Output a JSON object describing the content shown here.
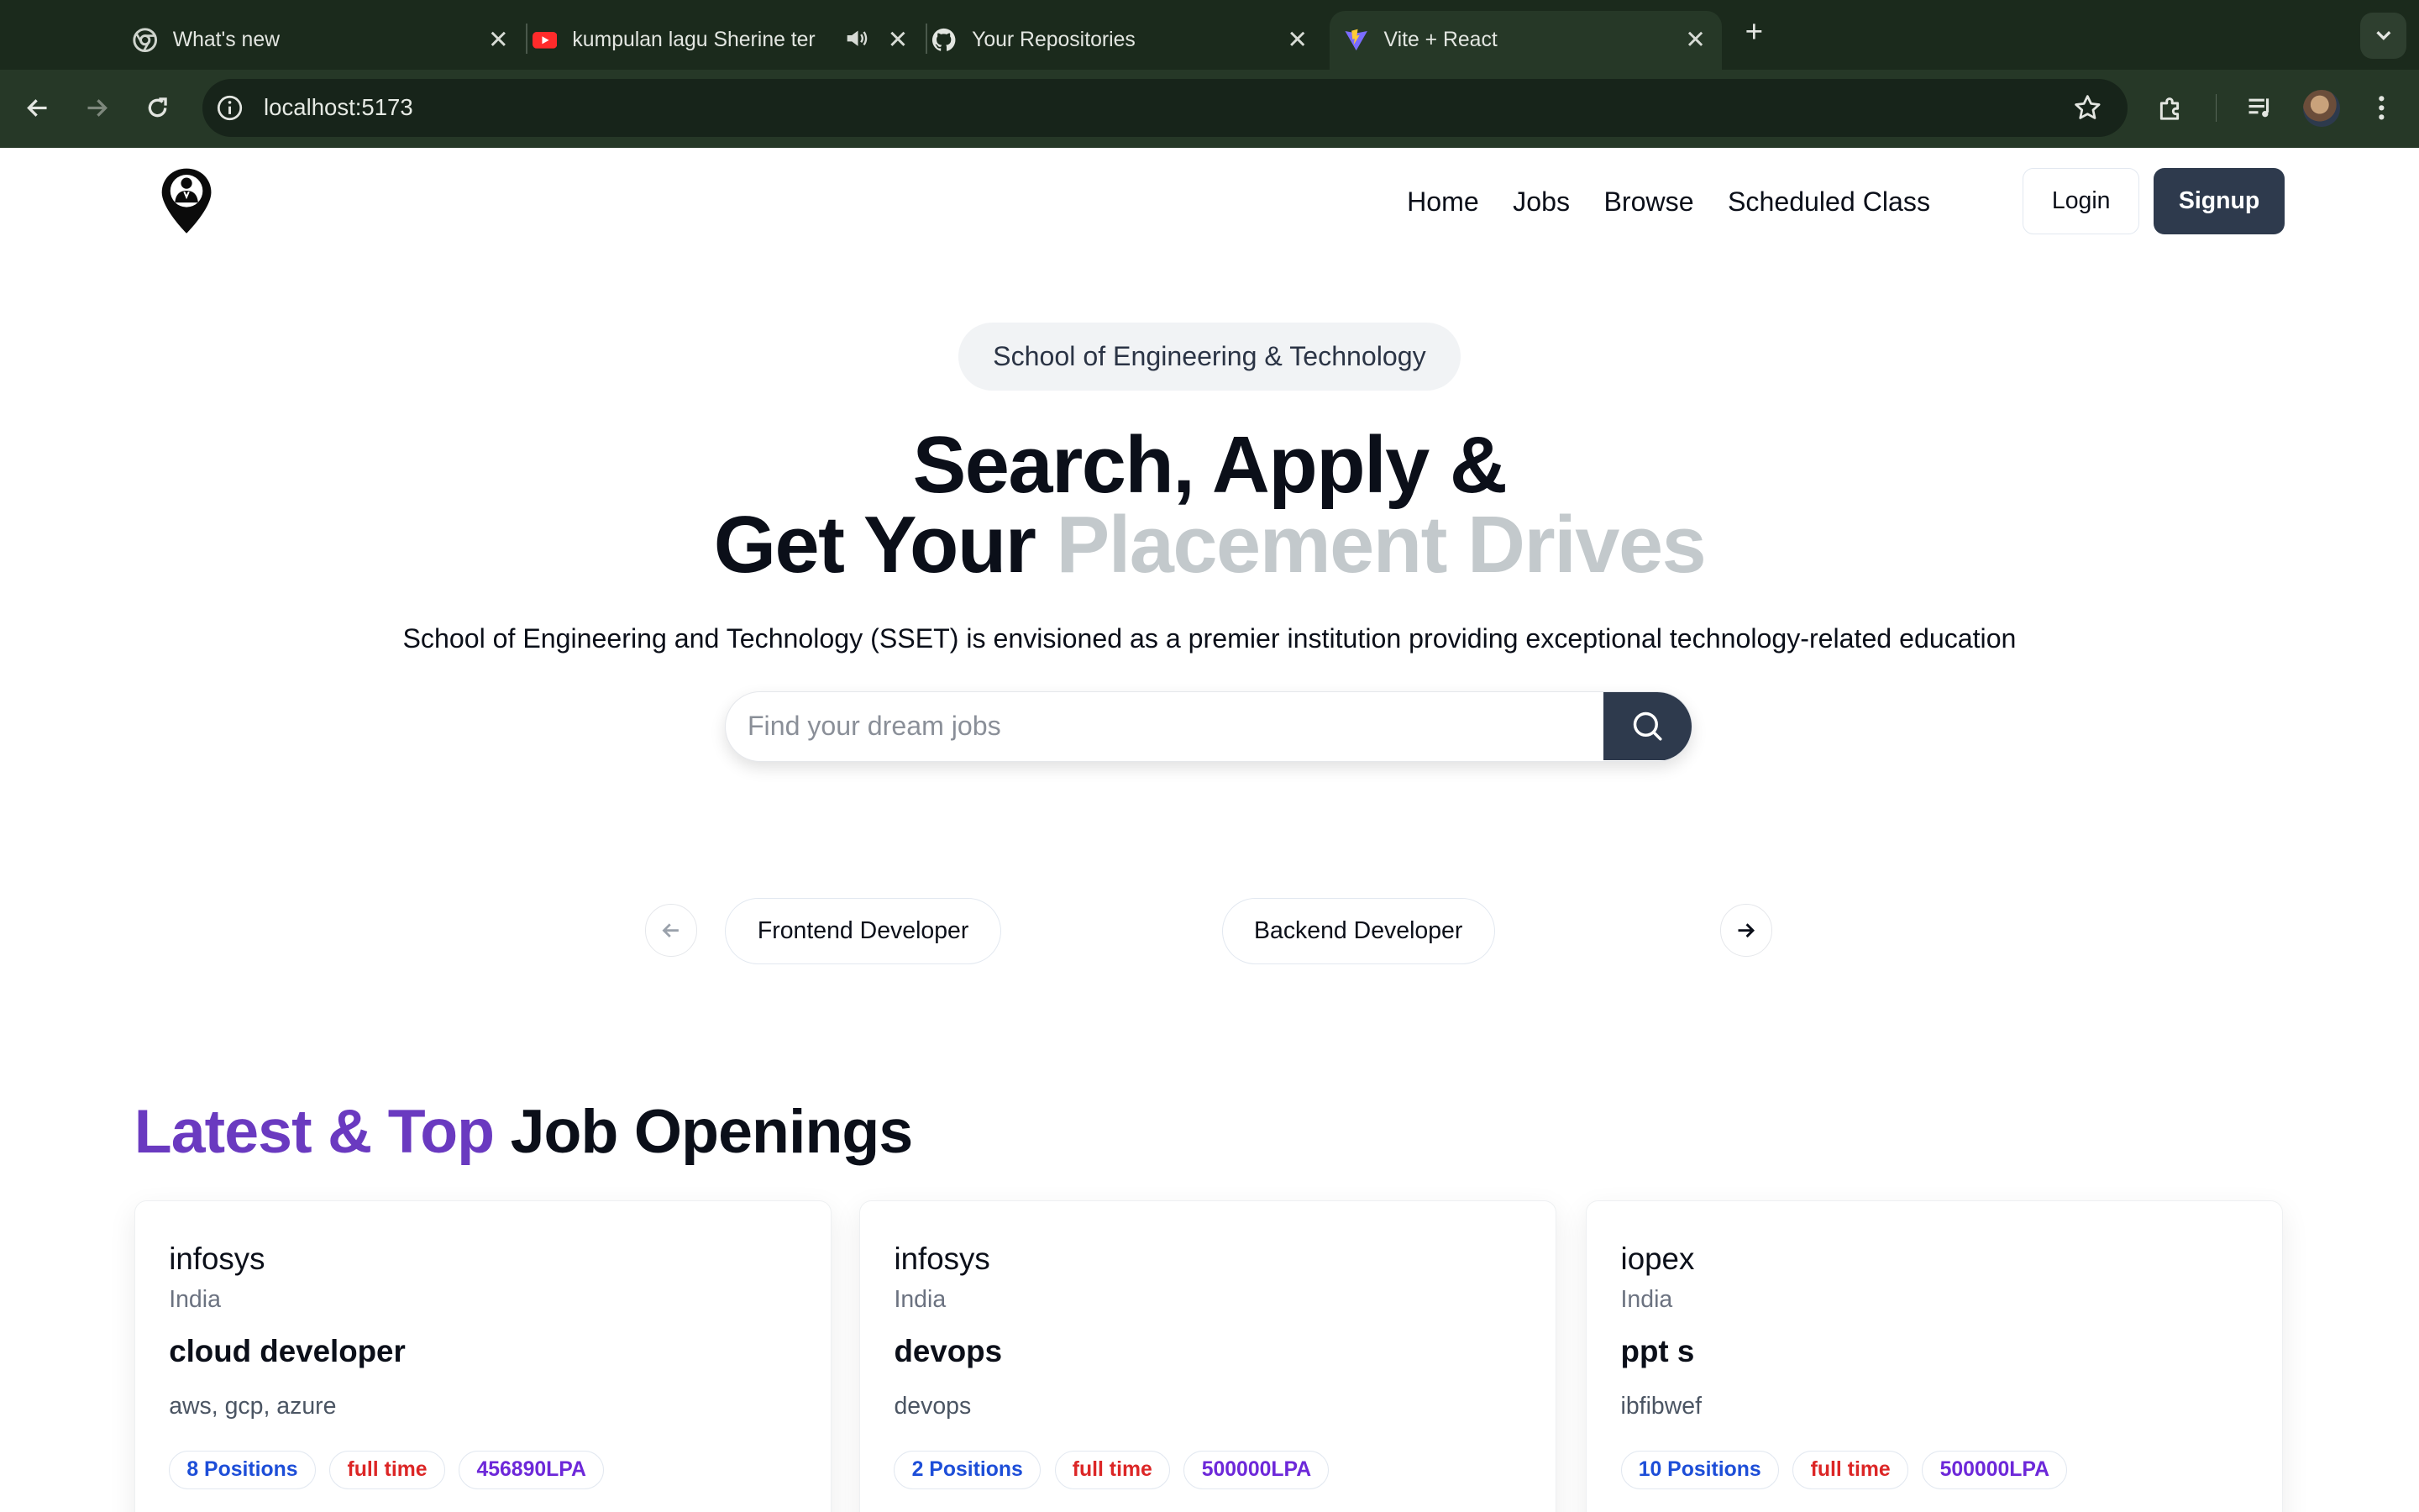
{
  "browser": {
    "tabs": [
      {
        "title": "What's new",
        "icon": "chrome-icon"
      },
      {
        "title": "kumpulan lagu Sherine ter",
        "icon": "youtube-icon"
      },
      {
        "title": "Your Repositories",
        "icon": "github-icon"
      },
      {
        "title": "Vite + React",
        "icon": "vite-icon",
        "active": true
      }
    ],
    "url": "localhost:5173"
  },
  "header": {
    "nav": [
      "Home",
      "Jobs",
      "Browse",
      "Scheduled Class"
    ],
    "login_label": "Login",
    "signup_label": "Signup"
  },
  "hero": {
    "badge": "School of Engineering & Technology",
    "title_line1": "Search, Apply &",
    "title_line2_start": "Get Your ",
    "title_line2_highlight": "Placement Drives",
    "subtitle": "School of Engineering and Technology (SSET) is envisioned as a premier institution providing exceptional technology-related education",
    "search_placeholder": "Find your dream jobs"
  },
  "categories": [
    "Frontend Developer",
    "Backend Developer"
  ],
  "jobs_section": {
    "title_accent": "Latest & Top",
    "title_rest": " Job Openings"
  },
  "jobs": [
    {
      "company": "infosys",
      "location": "India",
      "role": "cloud developer",
      "description": "aws, gcp, azure",
      "positions": "8 Positions",
      "type": "full time",
      "salary": "456890LPA"
    },
    {
      "company": "infosys",
      "location": "India",
      "role": "devops",
      "description": "devops",
      "positions": "2 Positions",
      "type": "full time",
      "salary": "500000LPA"
    },
    {
      "company": "iopex",
      "location": "India",
      "role": "ppt s",
      "description": "ibfibwef",
      "positions": "10 Positions",
      "type": "full time",
      "salary": "500000LPA"
    }
  ],
  "colors": {
    "accent": "#6a3ac0",
    "primary_button": "#2e3a4d",
    "browser_frame": "#1b2a1c"
  }
}
